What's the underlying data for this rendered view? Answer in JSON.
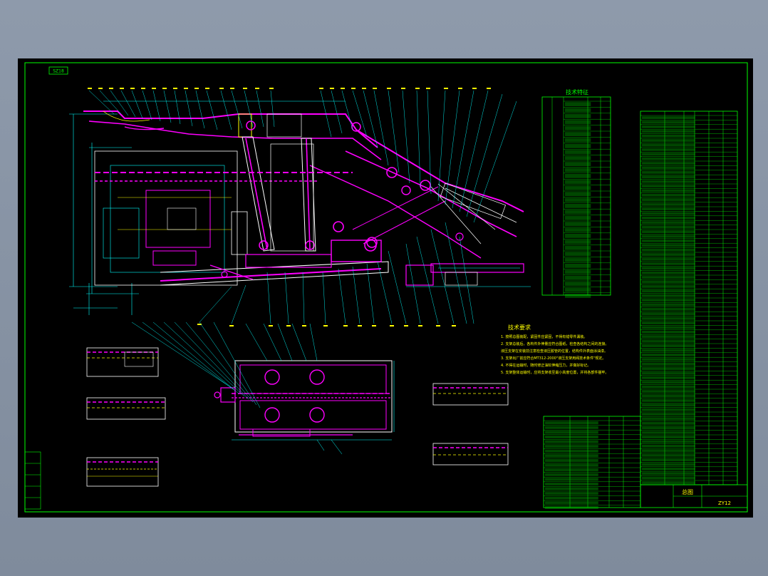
{
  "drawing": {
    "corner_tag": "SZ18",
    "tech_requirements": {
      "title": "技术要求",
      "items": [
        "1. 按照总图装配，紧固件应紧固，不得有错零件漏装。",
        "2. 支架总装后，各构件外伸量应符合图纸，检查各结构之间的连接。",
        "   液压支架在安装前注意检查液压胶管的位置，结构件外表面涂油漆。",
        "3. 支架出厂前应符合MT312-2000\"液压支架用阀技术条件\"规定。",
        "4. 不得在运输时，随时修正油缸伸缩压力，并做好标记。",
        "5. 支架整体运输时，应将支架收至最小高度位置，并将各部件捆牢。"
      ]
    },
    "tech_spec_table": {
      "title": "技术特征"
    },
    "title_block": {
      "name": "总图",
      "code": "ZY12"
    }
  },
  "colors": {
    "background": "#000000",
    "frame": "#00ff00",
    "parts": "#ff00ff",
    "leaders": "#00ffff",
    "notes": "#ffff00",
    "outline": "#ffffff",
    "table": "#00ff00"
  }
}
